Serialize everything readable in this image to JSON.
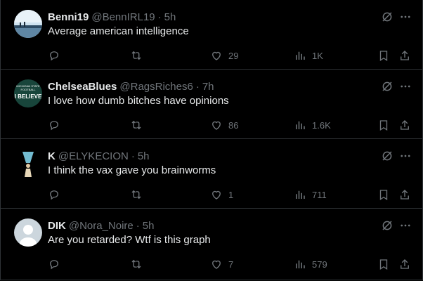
{
  "colors": {
    "background": "#000000",
    "text": "#e7e9ea",
    "muted": "#71767b",
    "divider": "#2f3336"
  },
  "tweets": [
    {
      "name": "Benni19",
      "handle": "@BennIRL19",
      "separator": "·",
      "time": "5h",
      "text": "Average american intelligence",
      "likes": "29",
      "views": "1K",
      "avatar": "sky-landscape-avatar"
    },
    {
      "name": "ChelseaBlues",
      "handle": "@RagsRiches6",
      "separator": "·",
      "time": "7h",
      "text": "I love how dumb bitches have opinions",
      "likes": "86",
      "views": "1.6K",
      "avatar": "michigan-state-avatar",
      "avatar_text": {
        "line1": "MICHIGAN STATE",
        "line2": "FOOTBALL",
        "line3": "I BELIEVE"
      }
    },
    {
      "name": "K",
      "handle": "@ELYKECION",
      "separator": "·",
      "time": "5h",
      "text": "I think the vax gave you brainworms",
      "likes": "1",
      "views": "711",
      "avatar": "figure-light-avatar"
    },
    {
      "name": "DIK",
      "handle": "@Nora_Noire",
      "separator": "·",
      "time": "5h",
      "text": "Are you retarded? Wtf is this graph",
      "likes": "7",
      "views": "579",
      "avatar": "default-avatar"
    }
  ]
}
